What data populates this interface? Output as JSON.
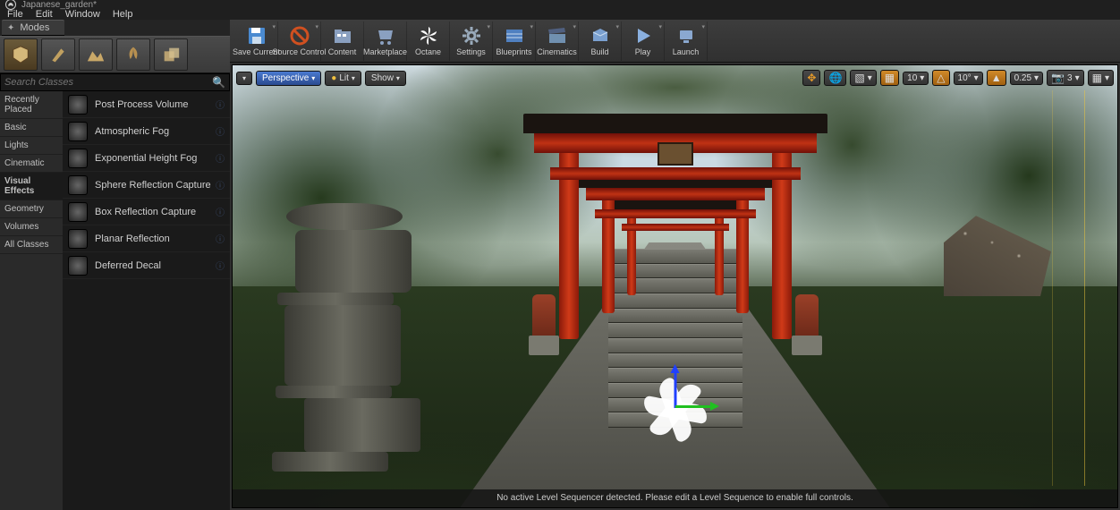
{
  "title": "Japanese_garden*",
  "menubar": [
    "File",
    "Edit",
    "Window",
    "Help"
  ],
  "modes_tab": "Modes",
  "search_placeholder": "Search Classes",
  "categories": [
    "Recently Placed",
    "Basic",
    "Lights",
    "Cinematic",
    "Visual Effects",
    "Geometry",
    "Volumes",
    "All Classes"
  ],
  "selected_category_index": 4,
  "assets": [
    "Post Process Volume",
    "Atmospheric Fog",
    "Exponential Height Fog",
    "Sphere Reflection Capture",
    "Box Reflection Capture",
    "Planar Reflection",
    "Deferred Decal"
  ],
  "toolbar": [
    {
      "label": "Save Current",
      "icon": "floppy-icon",
      "dd": true
    },
    {
      "label": "Source Control",
      "icon": "ban-icon",
      "dd": true
    },
    {
      "label": "Content",
      "icon": "folder-icon",
      "dd": false
    },
    {
      "label": "Marketplace",
      "icon": "cart-icon",
      "dd": false
    },
    {
      "label": "Octane",
      "icon": "octane-icon",
      "dd": false
    },
    {
      "label": "Settings",
      "icon": "gear-icon",
      "dd": true
    },
    {
      "label": "Blueprints",
      "icon": "blueprint-icon",
      "dd": true
    },
    {
      "label": "Cinematics",
      "icon": "clapper-icon",
      "dd": true
    },
    {
      "label": "Build",
      "icon": "build-icon",
      "dd": true
    },
    {
      "label": "Play",
      "icon": "play-icon",
      "dd": true
    },
    {
      "label": "Launch",
      "icon": "launch-icon",
      "dd": true
    }
  ],
  "viewport": {
    "dropdown": "▾",
    "perspective": "Perspective",
    "lit": "Lit",
    "show": "Show",
    "status": "No active Level Sequencer detected. Please edit a Level Sequence to enable full controls.",
    "snap_angle": "10°",
    "snap_grid": "10",
    "snap_scale": "0.25",
    "cam_speed": "3"
  }
}
